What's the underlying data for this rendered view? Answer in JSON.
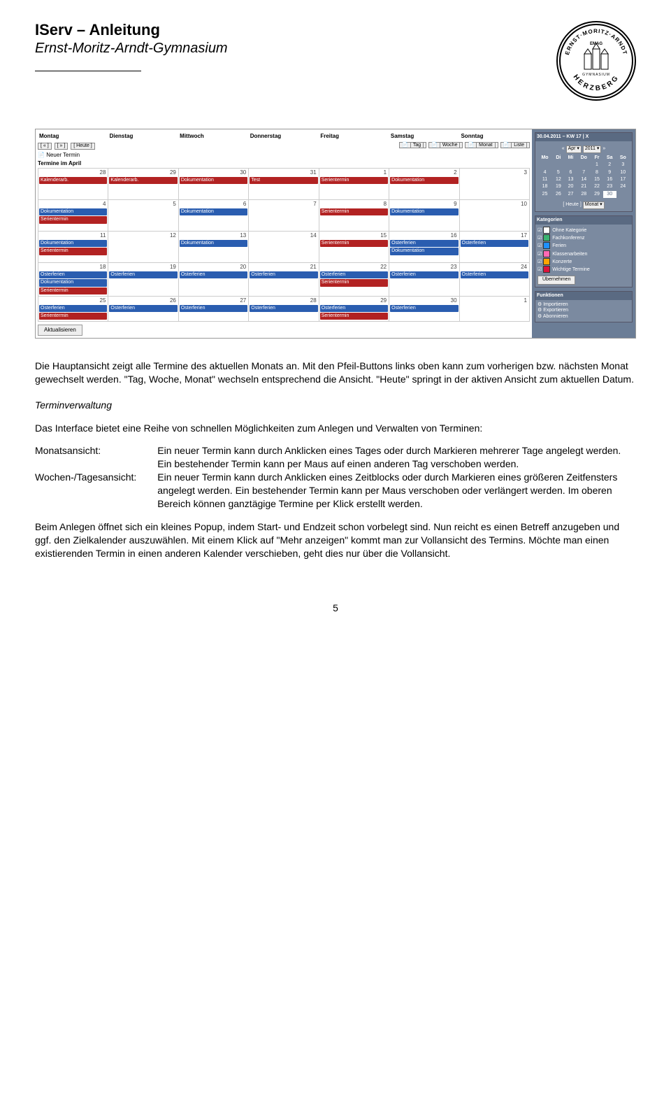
{
  "header": {
    "title": "IServ – Anleitung",
    "subtitle": "Ernst-Moritz-Arndt-Gymnasium",
    "logo_top": "ERNST·MORITZ·ARNDT",
    "logo_bottom": "HERZBERG",
    "logo_center": "EMAG",
    "logo_sub": "GYMNASIUM"
  },
  "screenshot": {
    "weekdays": [
      "Montag",
      "Dienstag",
      "Mittwoch",
      "Donnerstag",
      "Freitag",
      "Samstag",
      "Sonntag"
    ],
    "nav": {
      "prev": "«",
      "next": "»",
      "today": "Heute"
    },
    "new_event": "Neuer Termin",
    "section_title": "Termine im April",
    "views": {
      "day": "Tag",
      "week": "Woche",
      "month": "Monat",
      "list": "Liste"
    },
    "refresh_btn": "Aktualisieren",
    "rows": [
      {
        "days": [
          "28",
          "29",
          "30",
          "31",
          "1",
          "2",
          "3"
        ],
        "events": [
          [
            {
              "cls": "ev-red",
              "t": "Kalenderarb."
            }
          ],
          [
            {
              "cls": "ev-red",
              "t": "Kalenderarb."
            }
          ],
          [
            {
              "cls": "ev-red",
              "t": "Dokumentation"
            }
          ],
          [
            {
              "cls": "ev-red",
              "t": "Test"
            }
          ],
          [
            {
              "cls": "ev-red",
              "t": "Serientermin"
            }
          ],
          [
            {
              "cls": "ev-red",
              "t": "Dokumentation"
            }
          ],
          []
        ]
      },
      {
        "days": [
          "4",
          "5",
          "6",
          "7",
          "8",
          "9",
          "10"
        ],
        "events": [
          [
            {
              "cls": "ev-blue",
              "t": "Dokumentation"
            },
            {
              "cls": "ev-red",
              "t": "Serientermin"
            }
          ],
          [],
          [
            {
              "cls": "ev-blue",
              "t": "Dokumentation"
            }
          ],
          [],
          [
            {
              "cls": "ev-red",
              "t": "Serientermin"
            }
          ],
          [
            {
              "cls": "ev-blue",
              "t": "Dokumentation"
            }
          ],
          []
        ]
      },
      {
        "days": [
          "11",
          "12",
          "13",
          "14",
          "15",
          "16",
          "17"
        ],
        "events": [
          [
            {
              "cls": "ev-blue",
              "t": "Dokumentation"
            },
            {
              "cls": "ev-red",
              "t": "Serientermin"
            }
          ],
          [],
          [
            {
              "cls": "ev-blue",
              "t": "Dokumentation"
            }
          ],
          [],
          [
            {
              "cls": "ev-red",
              "t": "Serientermin"
            }
          ],
          [
            {
              "cls": "ev-blue",
              "t": "Osterferien"
            },
            {
              "cls": "ev-blue",
              "t": "Dokumentation"
            }
          ],
          [
            {
              "cls": "ev-blue",
              "t": "Osterferien"
            }
          ]
        ]
      },
      {
        "days": [
          "18",
          "19",
          "20",
          "21",
          "22",
          "23",
          "24"
        ],
        "events": [
          [
            {
              "cls": "ev-blue",
              "t": "Osterferien"
            },
            {
              "cls": "ev-blue",
              "t": "Dokumentation"
            },
            {
              "cls": "ev-red",
              "t": "Serientermin"
            }
          ],
          [
            {
              "cls": "ev-blue",
              "t": "Osterferien"
            }
          ],
          [
            {
              "cls": "ev-blue",
              "t": "Osterferien"
            }
          ],
          [
            {
              "cls": "ev-blue",
              "t": "Osterferien"
            }
          ],
          [
            {
              "cls": "ev-blue",
              "t": "Osterferien"
            },
            {
              "cls": "ev-red",
              "t": "Serientermin"
            }
          ],
          [
            {
              "cls": "ev-blue",
              "t": "Osterferien"
            }
          ],
          [
            {
              "cls": "ev-blue",
              "t": "Osterferien"
            }
          ]
        ]
      },
      {
        "days": [
          "25",
          "26",
          "27",
          "28",
          "29",
          "30",
          "1"
        ],
        "short": true,
        "events": [
          [
            {
              "cls": "ev-blue",
              "t": "Osterferien"
            },
            {
              "cls": "ev-red",
              "t": "Serientermin"
            }
          ],
          [
            {
              "cls": "ev-blue",
              "t": "Osterferien"
            }
          ],
          [
            {
              "cls": "ev-blue",
              "t": "Osterferien"
            }
          ],
          [
            {
              "cls": "ev-blue",
              "t": "Osterferien"
            }
          ],
          [
            {
              "cls": "ev-blue",
              "t": "Osterferien"
            },
            {
              "cls": "ev-red",
              "t": "Serientermin"
            }
          ],
          [
            {
              "cls": "ev-blue",
              "t": "Osterferien"
            }
          ],
          []
        ]
      }
    ],
    "side": {
      "date_header": "30.04.2011 – KW 17 | X",
      "month_sel": "Apr",
      "year_sel": "2011",
      "mini_days": [
        "Mo",
        "Di",
        "Mi",
        "Do",
        "Fr",
        "Sa",
        "So"
      ],
      "mini_rows": [
        [
          "",
          "",
          "",
          "",
          "1",
          "2",
          "3"
        ],
        [
          "4",
          "5",
          "6",
          "7",
          "8",
          "9",
          "10"
        ],
        [
          "11",
          "12",
          "13",
          "14",
          "15",
          "16",
          "17"
        ],
        [
          "18",
          "19",
          "20",
          "21",
          "22",
          "23",
          "24"
        ],
        [
          "25",
          "26",
          "27",
          "28",
          "29",
          "30",
          ""
        ]
      ],
      "today_btn": "Heute",
      "view_sel": "Monat",
      "cat_title": "Kategorien",
      "categories": [
        {
          "color": "#ffffff",
          "label": "Ohne Kategorie"
        },
        {
          "color": "#3cb371",
          "label": "Fachkonferenz"
        },
        {
          "color": "#1e90ff",
          "label": "Ferien"
        },
        {
          "color": "#ff69b4",
          "label": "Klassenarbeiten"
        },
        {
          "color": "#ffa500",
          "label": "Konzerte"
        },
        {
          "color": "#dc143c",
          "label": "Wichtige Termine"
        }
      ],
      "apply_btn": "Übernehmen",
      "func_title": "Funktionen",
      "functions": [
        "Importieren",
        "Exportieren",
        "Abonnieren"
      ]
    }
  },
  "body": {
    "p1": "Die Hauptansicht zeigt alle Termine des aktuellen Monats an. Mit den Pfeil-Buttons links oben kann zum vorherigen bzw. nächsten Monat gewechselt werden. \"Tag, Woche, Monat\" wechseln entsprechend die Ansicht. \"Heute\" springt in der aktiven Ansicht zum aktuellen Datum.",
    "sub1": "Terminverwaltung",
    "p2": "Das Interface bietet eine Reihe von schnellen Möglichkeiten zum Anlegen und Verwalten von Terminen:",
    "d1_label": "Monatsansicht:",
    "d1_text": "Ein neuer Termin kann durch Anklicken eines Tages oder durch Markieren mehrerer Tage angelegt werden. Ein bestehender Termin kann per Maus auf einen anderen Tag verschoben werden.",
    "d2_label": "Wochen-/Tagesansicht:",
    "d2_text": "Ein neuer Termin kann durch Anklicken eines Zeitblocks oder durch Markieren eines größeren Zeitfensters angelegt werden. Ein bestehender Termin kann per Maus verschoben oder verlängert werden. Im oberen Bereich können ganztägige Termine per Klick erstellt werden.",
    "p3": "Beim Anlegen öffnet sich ein kleines Popup, indem Start- und Endzeit schon vorbelegt sind. Nun reicht es einen Betreff anzugeben und ggf. den Zielkalender auszuwählen. Mit einem Klick auf \"Mehr anzeigen\" kommt man zur Vollansicht des Termins. Möchte man einen existierenden Termin in einen anderen Kalender verschieben, geht dies nur über die Vollansicht."
  },
  "page_number": "5"
}
